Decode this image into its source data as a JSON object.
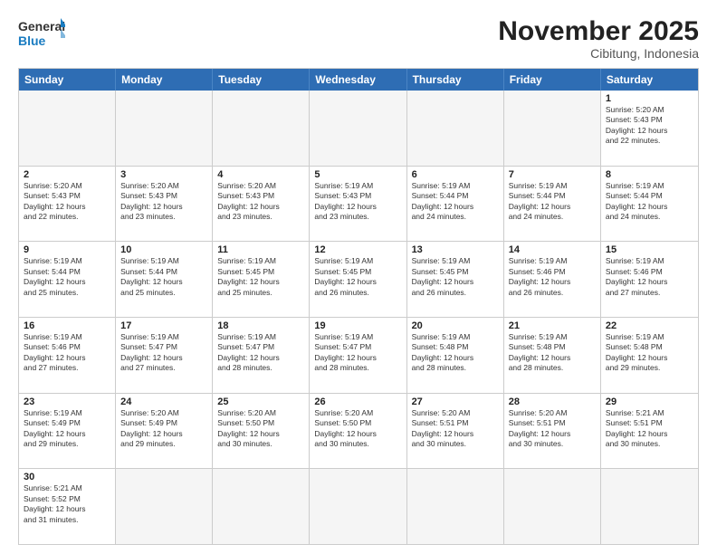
{
  "header": {
    "logo_general": "General",
    "logo_blue": "Blue",
    "title": "November 2025",
    "subtitle": "Cibitung, Indonesia"
  },
  "days_of_week": [
    "Sunday",
    "Monday",
    "Tuesday",
    "Wednesday",
    "Thursday",
    "Friday",
    "Saturday"
  ],
  "weeks": [
    [
      {
        "day": "",
        "info": ""
      },
      {
        "day": "",
        "info": ""
      },
      {
        "day": "",
        "info": ""
      },
      {
        "day": "",
        "info": ""
      },
      {
        "day": "",
        "info": ""
      },
      {
        "day": "",
        "info": ""
      },
      {
        "day": "1",
        "info": "Sunrise: 5:20 AM\nSunset: 5:43 PM\nDaylight: 12 hours\nand 22 minutes."
      }
    ],
    [
      {
        "day": "2",
        "info": "Sunrise: 5:20 AM\nSunset: 5:43 PM\nDaylight: 12 hours\nand 22 minutes."
      },
      {
        "day": "3",
        "info": "Sunrise: 5:20 AM\nSunset: 5:43 PM\nDaylight: 12 hours\nand 23 minutes."
      },
      {
        "day": "4",
        "info": "Sunrise: 5:20 AM\nSunset: 5:43 PM\nDaylight: 12 hours\nand 23 minutes."
      },
      {
        "day": "5",
        "info": "Sunrise: 5:19 AM\nSunset: 5:43 PM\nDaylight: 12 hours\nand 23 minutes."
      },
      {
        "day": "6",
        "info": "Sunrise: 5:19 AM\nSunset: 5:44 PM\nDaylight: 12 hours\nand 24 minutes."
      },
      {
        "day": "7",
        "info": "Sunrise: 5:19 AM\nSunset: 5:44 PM\nDaylight: 12 hours\nand 24 minutes."
      },
      {
        "day": "8",
        "info": "Sunrise: 5:19 AM\nSunset: 5:44 PM\nDaylight: 12 hours\nand 24 minutes."
      }
    ],
    [
      {
        "day": "9",
        "info": "Sunrise: 5:19 AM\nSunset: 5:44 PM\nDaylight: 12 hours\nand 25 minutes."
      },
      {
        "day": "10",
        "info": "Sunrise: 5:19 AM\nSunset: 5:44 PM\nDaylight: 12 hours\nand 25 minutes."
      },
      {
        "day": "11",
        "info": "Sunrise: 5:19 AM\nSunset: 5:45 PM\nDaylight: 12 hours\nand 25 minutes."
      },
      {
        "day": "12",
        "info": "Sunrise: 5:19 AM\nSunset: 5:45 PM\nDaylight: 12 hours\nand 26 minutes."
      },
      {
        "day": "13",
        "info": "Sunrise: 5:19 AM\nSunset: 5:45 PM\nDaylight: 12 hours\nand 26 minutes."
      },
      {
        "day": "14",
        "info": "Sunrise: 5:19 AM\nSunset: 5:46 PM\nDaylight: 12 hours\nand 26 minutes."
      },
      {
        "day": "15",
        "info": "Sunrise: 5:19 AM\nSunset: 5:46 PM\nDaylight: 12 hours\nand 27 minutes."
      }
    ],
    [
      {
        "day": "16",
        "info": "Sunrise: 5:19 AM\nSunset: 5:46 PM\nDaylight: 12 hours\nand 27 minutes."
      },
      {
        "day": "17",
        "info": "Sunrise: 5:19 AM\nSunset: 5:47 PM\nDaylight: 12 hours\nand 27 minutes."
      },
      {
        "day": "18",
        "info": "Sunrise: 5:19 AM\nSunset: 5:47 PM\nDaylight: 12 hours\nand 28 minutes."
      },
      {
        "day": "19",
        "info": "Sunrise: 5:19 AM\nSunset: 5:47 PM\nDaylight: 12 hours\nand 28 minutes."
      },
      {
        "day": "20",
        "info": "Sunrise: 5:19 AM\nSunset: 5:48 PM\nDaylight: 12 hours\nand 28 minutes."
      },
      {
        "day": "21",
        "info": "Sunrise: 5:19 AM\nSunset: 5:48 PM\nDaylight: 12 hours\nand 28 minutes."
      },
      {
        "day": "22",
        "info": "Sunrise: 5:19 AM\nSunset: 5:48 PM\nDaylight: 12 hours\nand 29 minutes."
      }
    ],
    [
      {
        "day": "23",
        "info": "Sunrise: 5:19 AM\nSunset: 5:49 PM\nDaylight: 12 hours\nand 29 minutes."
      },
      {
        "day": "24",
        "info": "Sunrise: 5:20 AM\nSunset: 5:49 PM\nDaylight: 12 hours\nand 29 minutes."
      },
      {
        "day": "25",
        "info": "Sunrise: 5:20 AM\nSunset: 5:50 PM\nDaylight: 12 hours\nand 30 minutes."
      },
      {
        "day": "26",
        "info": "Sunrise: 5:20 AM\nSunset: 5:50 PM\nDaylight: 12 hours\nand 30 minutes."
      },
      {
        "day": "27",
        "info": "Sunrise: 5:20 AM\nSunset: 5:51 PM\nDaylight: 12 hours\nand 30 minutes."
      },
      {
        "day": "28",
        "info": "Sunrise: 5:20 AM\nSunset: 5:51 PM\nDaylight: 12 hours\nand 30 minutes."
      },
      {
        "day": "29",
        "info": "Sunrise: 5:21 AM\nSunset: 5:51 PM\nDaylight: 12 hours\nand 30 minutes."
      }
    ],
    [
      {
        "day": "30",
        "info": "Sunrise: 5:21 AM\nSunset: 5:52 PM\nDaylight: 12 hours\nand 31 minutes."
      },
      {
        "day": "",
        "info": ""
      },
      {
        "day": "",
        "info": ""
      },
      {
        "day": "",
        "info": ""
      },
      {
        "day": "",
        "info": ""
      },
      {
        "day": "",
        "info": ""
      },
      {
        "day": "",
        "info": ""
      }
    ]
  ]
}
